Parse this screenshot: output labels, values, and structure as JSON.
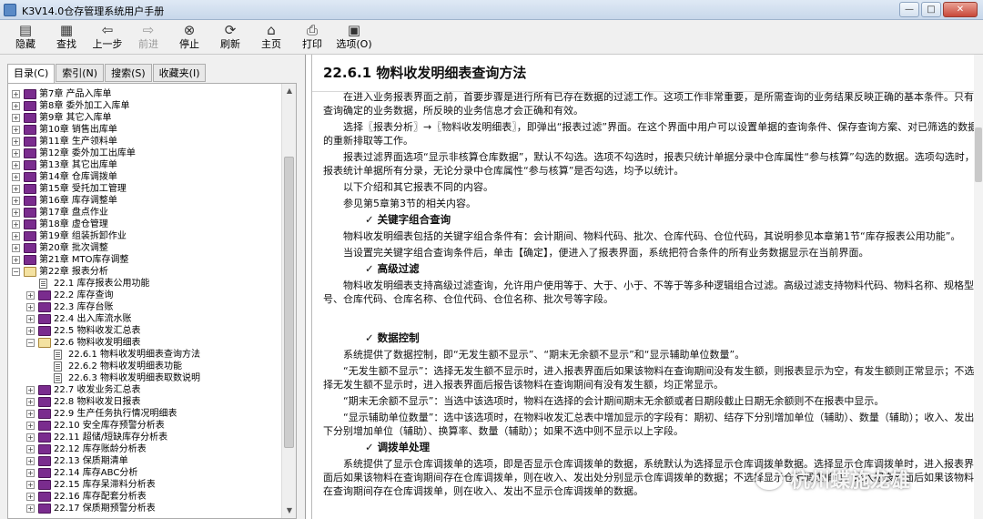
{
  "window": {
    "title": "K3V14.0仓存管理系统用户手册"
  },
  "toolbar": {
    "buttons": [
      {
        "label": "隐藏",
        "icon": "hide-icon"
      },
      {
        "label": "查找",
        "icon": "find-icon"
      },
      {
        "label": "上一步",
        "icon": "back-arrow-icon"
      },
      {
        "label": "前进",
        "icon": "forward-arrow-icon"
      },
      {
        "label": "停止",
        "icon": "stop-icon"
      },
      {
        "label": "刷新",
        "icon": "refresh-icon"
      },
      {
        "label": "主页",
        "icon": "home-icon"
      },
      {
        "label": "打印",
        "icon": "print-icon"
      },
      {
        "label": "选项(O)",
        "icon": "options-icon"
      }
    ]
  },
  "nav_tabs": [
    "目录(C)",
    "索引(N)",
    "搜索(S)",
    "收藏夹(I)"
  ],
  "tree": [
    {
      "label": "第7章  产品入库单",
      "level": 0,
      "kind": "book",
      "expander": "+"
    },
    {
      "label": "第8章  委外加工入库单",
      "level": 0,
      "kind": "book",
      "expander": "+"
    },
    {
      "label": "第9章  其它入库单",
      "level": 0,
      "kind": "book",
      "expander": "+"
    },
    {
      "label": "第10章  销售出库单",
      "level": 0,
      "kind": "book",
      "expander": "+"
    },
    {
      "label": "第11章  生产领料单",
      "level": 0,
      "kind": "book",
      "expander": "+"
    },
    {
      "label": "第12章  委外加工出库单",
      "level": 0,
      "kind": "book",
      "expander": "+"
    },
    {
      "label": "第13章  其它出库单",
      "level": 0,
      "kind": "book",
      "expander": "+"
    },
    {
      "label": "第14章  仓库调拨单",
      "level": 0,
      "kind": "book",
      "expander": "+"
    },
    {
      "label": "第15章  受托加工管理",
      "level": 0,
      "kind": "book",
      "expander": "+"
    },
    {
      "label": "第16章  库存调整单",
      "level": 0,
      "kind": "book",
      "expander": "+"
    },
    {
      "label": "第17章  盘点作业",
      "level": 0,
      "kind": "book",
      "expander": "+"
    },
    {
      "label": "第18章  虚仓管理",
      "level": 0,
      "kind": "book",
      "expander": "+"
    },
    {
      "label": "第19章  组装拆卸作业",
      "level": 0,
      "kind": "book",
      "expander": "+"
    },
    {
      "label": "第20章  批次调整",
      "level": 0,
      "kind": "book",
      "expander": "+"
    },
    {
      "label": "第21章  MTO库存调整",
      "level": 0,
      "kind": "book",
      "expander": "+"
    },
    {
      "label": "第22章  报表分析",
      "level": 0,
      "kind": "book-open",
      "expander": "-"
    },
    {
      "label": "22.1  库存报表公用功能",
      "level": 1,
      "kind": "page",
      "expander": ""
    },
    {
      "label": "22.2  库存查询",
      "level": 1,
      "kind": "book",
      "expander": "+"
    },
    {
      "label": "22.3  库存台账",
      "level": 1,
      "kind": "book",
      "expander": "+"
    },
    {
      "label": "22.4  出入库流水账",
      "level": 1,
      "kind": "book",
      "expander": "+"
    },
    {
      "label": "22.5  物料收发汇总表",
      "level": 1,
      "kind": "book",
      "expander": "+"
    },
    {
      "label": "22.6  物料收发明细表",
      "level": 1,
      "kind": "book-open",
      "expander": "-"
    },
    {
      "label": "22.6.1  物料收发明细表查询方法",
      "level": 2,
      "kind": "page",
      "expander": "",
      "selected": true
    },
    {
      "label": "22.6.2  物料收发明细表功能",
      "level": 2,
      "kind": "page",
      "expander": ""
    },
    {
      "label": "22.6.3  物料收发明细表取数说明",
      "level": 2,
      "kind": "page",
      "expander": ""
    },
    {
      "label": "22.7  收发业务汇总表",
      "level": 1,
      "kind": "book",
      "expander": "+"
    },
    {
      "label": "22.8  物料收发日报表",
      "level": 1,
      "kind": "book",
      "expander": "+"
    },
    {
      "label": "22.9  生产任务执行情况明细表",
      "level": 1,
      "kind": "book",
      "expander": "+"
    },
    {
      "label": "22.10  安全库存预警分析表",
      "level": 1,
      "kind": "book",
      "expander": "+"
    },
    {
      "label": "22.11  超储/短缺库存分析表",
      "level": 1,
      "kind": "book",
      "expander": "+"
    },
    {
      "label": "22.12  库存账龄分析表",
      "level": 1,
      "kind": "book",
      "expander": "+"
    },
    {
      "label": "22.13  保质期清单",
      "level": 1,
      "kind": "book",
      "expander": "+"
    },
    {
      "label": "22.14  库存ABC分析",
      "level": 1,
      "kind": "book",
      "expander": "+"
    },
    {
      "label": "22.15  库存呆滞料分析表",
      "level": 1,
      "kind": "book",
      "expander": "+"
    },
    {
      "label": "22.16  库存配套分析表",
      "level": 1,
      "kind": "book",
      "expander": "+"
    },
    {
      "label": "22.17  保质期预警分析表",
      "level": 1,
      "kind": "book",
      "expander": "+"
    }
  ],
  "document": {
    "title": "22.6.1 物料收发明细表查询方法",
    "blocks": [
      {
        "type": "p",
        "text": "在进入业务报表界面之前，首要步骤是进行所有已存在数据的过滤工作。这项工作非常重要，是所需查询的业务结果反映正确的基本条件。只有查询确定的业务数据，所反映的业务信息才会正确和有效。"
      },
      {
        "type": "p",
        "text": "选择〖报表分析〗→〖物料收发明细表〗，即弹出“报表过滤”界面。在这个界面中用户可以设置单据的查询条件、保存查询方案、对已筛选的数据的重新排取等工作。"
      },
      {
        "type": "p",
        "text": "报表过滤界面选项“显示非核算仓库数据”，默认不勾选。选项不勾选时，报表只统计单据分录中仓库属性“参与核算”勾选的数据。选项勾选时，报表统计单据所有分录，无论分录中仓库属性“参与核算”是否勾选，均予以统计。"
      },
      {
        "type": "p",
        "text": "以下介绍和其它报表不同的内容。"
      },
      {
        "type": "p",
        "text": "参见第5章第3节的相关内容。"
      },
      {
        "type": "h3",
        "text": "✓   关键字组合查询"
      },
      {
        "type": "p",
        "text": "物料收发明细表包括的关键字组合条件有：会计期间、物料代码、批次、仓库代码、仓位代码，其说明参见本章第1节“库存报表公用功能”。"
      },
      {
        "type": "p",
        "text": "当设置完关键字组合查询条件后，单击【确定】，便进入了报表界面，系统把符合条件的所有业务数据显示在当前界面。"
      },
      {
        "type": "h3",
        "text": "✓   高级过滤"
      },
      {
        "type": "p",
        "text": "物料收发明细表支持高级过滤查询，允许用户使用等于、大于、小于、不等于等多种逻辑组合过滤。高级过滤支持物料代码、物料名称、规格型号、仓库代码、仓库名称、仓位代码、仓位名称、批次号等字段。"
      },
      {
        "type": "gap",
        "text": ""
      },
      {
        "type": "h3",
        "text": "✓   数据控制"
      },
      {
        "type": "p",
        "text": "系统提供了数据控制，即“无发生额不显示”、“期末无余额不显示”和“显示辅助单位数量”。"
      },
      {
        "type": "p",
        "text": "“无发生额不显示”：选择无发生额不显示时，进入报表界面后如果该物料在查询期间没有发生额，则报表显示为空，有发生额则正常显示；不选择无发生额不显示时，进入报表界面后报告该物料在查询期间有没有发生额，均正常显示。"
      },
      {
        "type": "p",
        "text": "“期末无余额不显示”：当选中该选项时，物料在选择的会计期间期末无余额或者日期段截止日期无余额则不在报表中显示。"
      },
      {
        "type": "p",
        "text": "“显示辅助单位数量”：选中该选项时，在物料收发汇总表中增加显示的字段有：期初、结存下分别增加单位（辅助）、数量（辅助）；收入、发出下分别增加单位（辅助）、换算率、数量（辅助）；如果不选中则不显示以上字段。"
      },
      {
        "type": "h3",
        "text": "✓   调拨单处理"
      },
      {
        "type": "p",
        "text": "系统提供了显示仓库调拨单的选项，即是否显示仓库调拨单的数据，系统默认为选择显示仓库调拨单数据。选择显示仓库调拨单时，进入报表界面后如果该物料在查询期间存在仓库调拨单，则在收入、发出处分别显示仓库调拨单的数据；不选择显示仓库调拨单时，进入报表界面后如果该物料在查询期间存在仓库调拨单，则在收入、发出不显示仓库调拨单的数据。"
      }
    ]
  },
  "watermark": {
    "text": "杭州蝶施龙雄"
  }
}
